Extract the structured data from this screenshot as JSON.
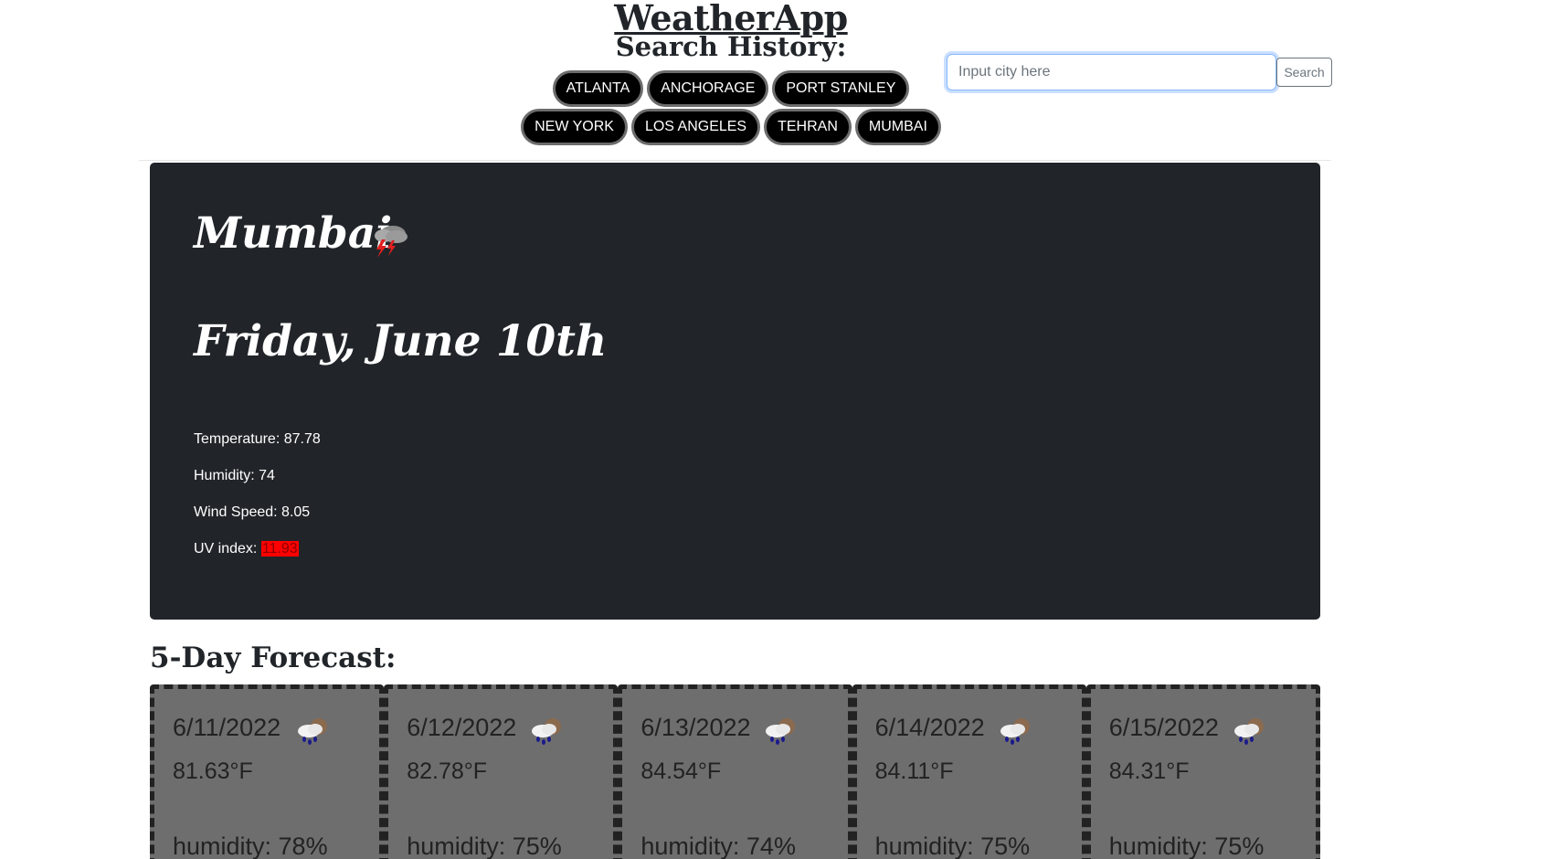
{
  "header": {
    "app_title": "WeatherApp",
    "history_title": "Search History:"
  },
  "history": {
    "row1": [
      "ATLANTA",
      "ANCHORAGE",
      "PORT STANLEY"
    ],
    "row2": [
      "NEW YORK",
      "LOS ANGELES",
      "TEHRAN",
      "MUMBAI"
    ]
  },
  "search": {
    "placeholder": "Input city here",
    "button_label": "Search"
  },
  "current": {
    "city": "Mumbai",
    "icon": "thunderstorm-icon",
    "date": "Friday, June 10th",
    "temperature": "Temperature: 87.78",
    "humidity": "Humidity: 74",
    "wind_speed": "Wind Speed: 8.05",
    "uv_label": "UV index:",
    "uv_value": "11.93",
    "uv_color": "#ff0000"
  },
  "forecast": {
    "title": "5-Day Forecast:",
    "days": [
      {
        "date": "6/11/2022",
        "icon": "rain-cloud-icon",
        "temp": "81.63°F",
        "humidity": "humidity: 78%"
      },
      {
        "date": "6/12/2022",
        "icon": "rain-cloud-icon",
        "temp": "82.78°F",
        "humidity": "humidity: 75%"
      },
      {
        "date": "6/13/2022",
        "icon": "rain-cloud-icon",
        "temp": "84.54°F",
        "humidity": "humidity: 74%"
      },
      {
        "date": "6/14/2022",
        "icon": "rain-cloud-icon",
        "temp": "84.11°F",
        "humidity": "humidity: 75%"
      },
      {
        "date": "6/15/2022",
        "icon": "rain-cloud-icon",
        "temp": "84.31°F",
        "humidity": "humidity: 75%"
      }
    ]
  },
  "colors": {
    "card_dark": "#212529",
    "forecast_card": "#6e6e6e",
    "history_button": "#000000"
  }
}
